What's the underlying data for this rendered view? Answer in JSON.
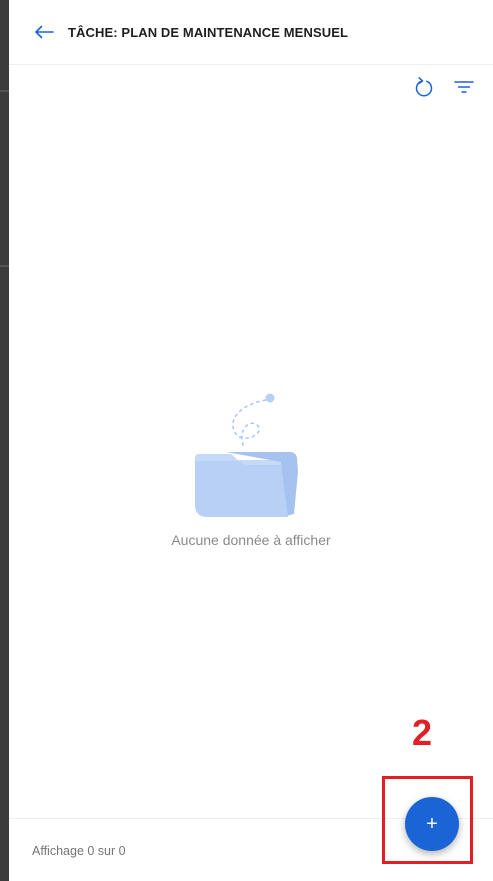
{
  "header": {
    "back_icon": "arrow-left-icon",
    "title": "TÂCHE: PLAN DE MAINTENANCE MENSUEL"
  },
  "toolbar": {
    "refresh_icon": "refresh-icon",
    "filter_icon": "filter-icon"
  },
  "empty_state": {
    "illustration": "empty-folder-icon",
    "message": "Aucune donnée à afficher"
  },
  "annotation": {
    "step_number": "2"
  },
  "fab": {
    "label": "+",
    "icon": "plus-icon"
  },
  "footer": {
    "summary": "Affichage 0 sur 0"
  },
  "colors": {
    "accent": "#1a64d6",
    "annotation_red": "#e31e24",
    "illustration_blue": "#b9d0f6"
  }
}
